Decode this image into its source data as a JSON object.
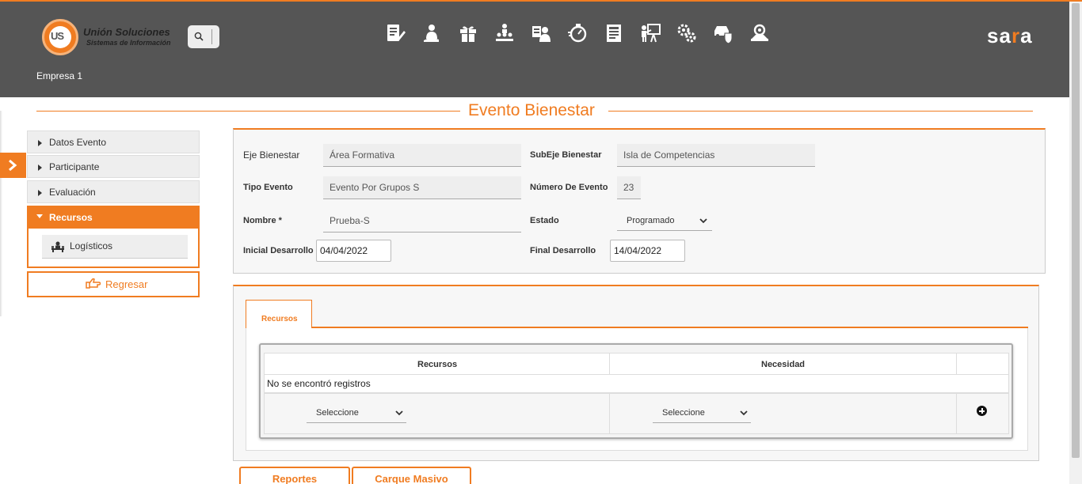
{
  "header": {
    "logo_title": "Unión Soluciones",
    "logo_subtitle": "Sistemas de Información",
    "logo_mark": "US",
    "brand": "sara",
    "company": "Empresa 1",
    "nav_icons": [
      "survey-icon",
      "person-hand-icon",
      "gift-icon",
      "org-chart-icon",
      "worker-id-icon",
      "timer-icon",
      "document-list-icon",
      "presenter-icon",
      "gears-icon",
      "car-shield-icon",
      "inspection-icon"
    ],
    "accent_color": "#f07c21",
    "header_color": "#555555"
  },
  "page": {
    "title": "Evento Bienestar"
  },
  "sidebar": {
    "items": [
      {
        "label": "Datos Evento"
      },
      {
        "label": "Participante"
      },
      {
        "label": "Evaluación"
      },
      {
        "label": "Recursos"
      }
    ],
    "active_item": "Recursos",
    "sub_items": [
      {
        "label": "Logísticos"
      }
    ],
    "back_label": "Regresar"
  },
  "form": {
    "eje_label": "Eje Bienestar",
    "eje_value": "Área Formativa",
    "subeje_label": "SubEje Bienestar",
    "subeje_value": "Isla de Competencias",
    "tipo_label": "Tipo Evento",
    "tipo_value": "Evento Por Grupos S",
    "numero_label": "Número De Evento",
    "numero_value": "23",
    "nombre_label": "Nombre *",
    "nombre_value": "Prueba-S",
    "estado_label": "Estado",
    "estado_value": "Programado",
    "inicial_label": "Inicial Desarrollo",
    "inicial_value": "04/04/2022",
    "final_label": "Final Desarrollo",
    "final_value": "14/04/2022"
  },
  "resources": {
    "tab_label": "Recursos",
    "columns": [
      "Recursos",
      "Necesidad"
    ],
    "empty_message": "No se encontró registros",
    "recurso_select": "Seleccione",
    "necesidad_select": "Seleccione"
  },
  "actions": {
    "reportes_label": "Reportes",
    "cargue_label": "Carque Masivo"
  }
}
